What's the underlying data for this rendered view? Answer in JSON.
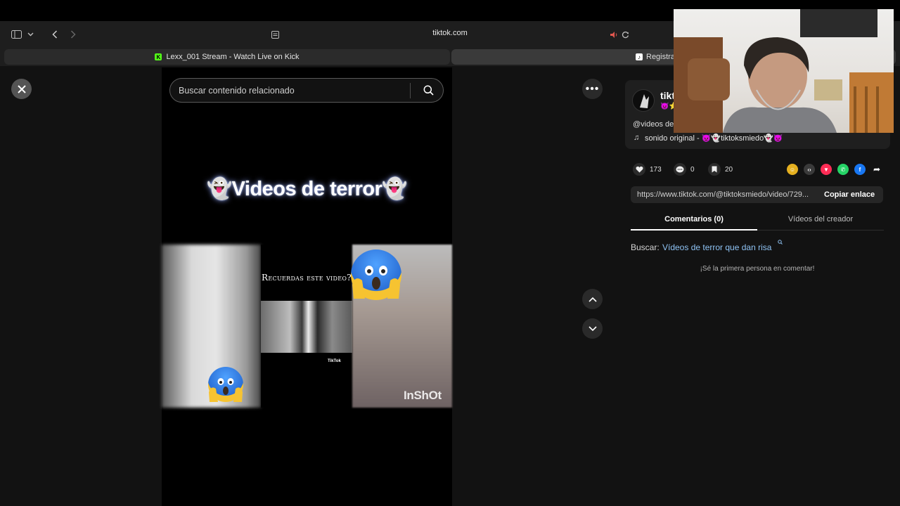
{
  "browser": {
    "url": "tiktok.com",
    "tabs": [
      {
        "label": "Lexx_001 Stream - Watch Live on Kick",
        "active": true
      },
      {
        "label": "Registra",
        "active": false
      }
    ],
    "icons": [
      "sidebar-icon",
      "chevron-down-icon",
      "back-icon",
      "forward-icon",
      "reader-icon",
      "speaker-icon",
      "reload-icon"
    ]
  },
  "viewer": {
    "search_placeholder": "Buscar contenido relacionado",
    "video_title": "👻Videos de terror👻",
    "overlay_text": "Recuerdas este video?",
    "watermark": "InShOt",
    "tiktok_mark": "TikTok",
    "more_label": "•••"
  },
  "details": {
    "author_name": "tikt",
    "author_emojis": "👿⭐",
    "handle": "@videos de",
    "music": "sonido original - 👿👻tiktoksmiedo👻👿",
    "likes": "173",
    "comments": "0",
    "saves": "20",
    "link": "https://www.tiktok.com/@tiktoksmiedo/video/729...",
    "copy_label": "Copiar enlace",
    "tabs": [
      "Comentarios (0)",
      "Vídeos del creador"
    ],
    "search_label": "Buscar:",
    "search_suggestion": "Vídeos de terror que dan risa",
    "empty_comments": "¡Sé la primera persona en comentar!"
  },
  "colors": {
    "accent_link": "#8fc3f4",
    "kick_green": "#53fc18"
  }
}
